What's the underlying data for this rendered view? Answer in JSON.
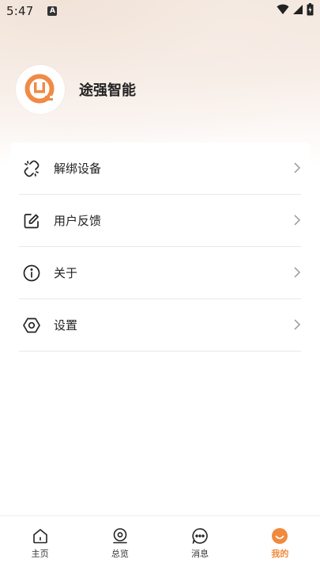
{
  "status_bar": {
    "time": "5:47",
    "app_icon": "A"
  },
  "profile": {
    "name": "途强智能"
  },
  "menu": [
    {
      "label": "解绑设备",
      "icon": "unlink-icon"
    },
    {
      "label": "用户反馈",
      "icon": "edit-icon"
    },
    {
      "label": "关于",
      "icon": "info-icon"
    },
    {
      "label": "设置",
      "icon": "settings-icon"
    }
  ],
  "tabs": [
    {
      "label": "主页",
      "icon": "home-icon"
    },
    {
      "label": "总览",
      "icon": "location-icon"
    },
    {
      "label": "消息",
      "icon": "message-icon"
    },
    {
      "label": "我的",
      "icon": "profile-icon",
      "active": true
    }
  ],
  "colors": {
    "accent": "#f08a3c",
    "logo": "#ef8b45"
  }
}
